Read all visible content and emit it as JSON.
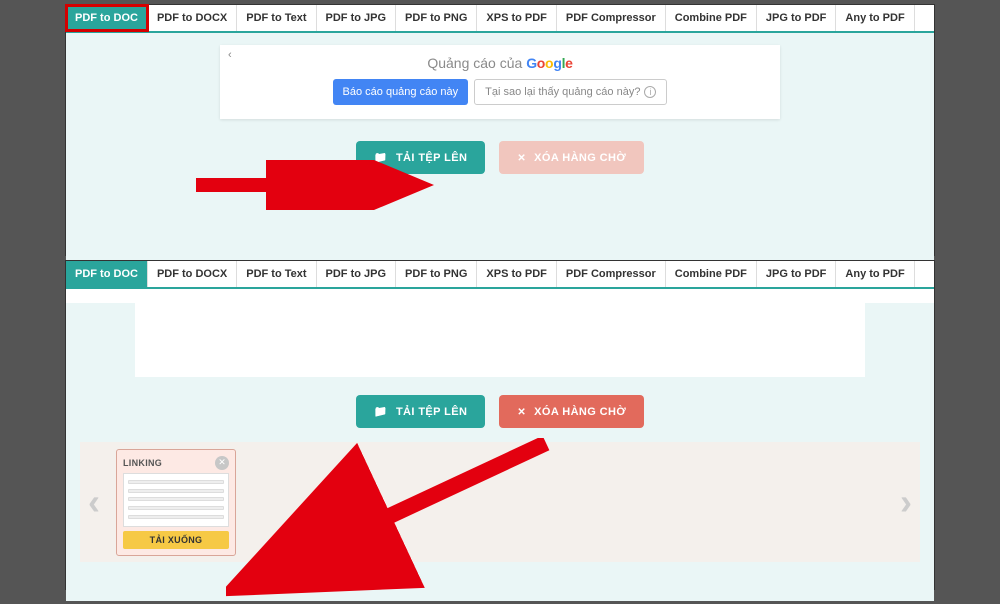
{
  "tabs": [
    {
      "label": "PDF to DOC",
      "active": true
    },
    {
      "label": "PDF to DOCX"
    },
    {
      "label": "PDF to Text"
    },
    {
      "label": "PDF to JPG"
    },
    {
      "label": "PDF to PNG"
    },
    {
      "label": "XPS to PDF"
    },
    {
      "label": "PDF Compressor"
    },
    {
      "label": "Combine PDF"
    },
    {
      "label": "JPG to PDF"
    },
    {
      "label": "Any to PDF"
    }
  ],
  "ad": {
    "close_glyph": "‹",
    "title_prefix": "Quảng cáo của ",
    "report_label": "Báo cáo quảng cáo này",
    "why_label": "Tại sao lại thấy quảng cáo này?"
  },
  "buttons": {
    "upload": "TẢI TỆP LÊN",
    "clear": "XÓA HÀNG CHỜ"
  },
  "file_card": {
    "title": "LINKING",
    "download": "TẢI XUỐNG"
  }
}
